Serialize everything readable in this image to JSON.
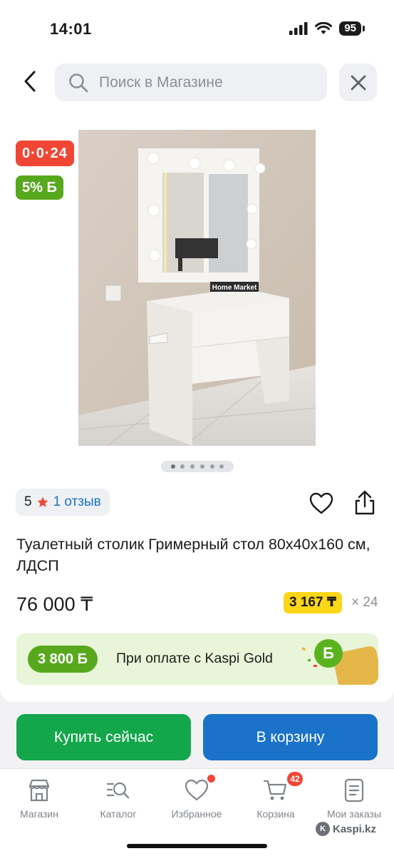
{
  "status_bar": {
    "time": "14:01",
    "battery": "95"
  },
  "header": {
    "search_placeholder": "Поиск в Магазине"
  },
  "product": {
    "badge_installment": "0·0·24",
    "badge_bonus": "5% Б",
    "image_brand_text": "Home Market",
    "gallery": {
      "total": 6,
      "active": 1
    },
    "rating": {
      "score": "5",
      "reviews": "1 отзыв"
    },
    "title": "Туалетный столик Гримерный стол 80х40х160 см, ЛДСП",
    "price": "76 000 ₸",
    "installment_price": "3 167 ₸",
    "installment_months": "× 24"
  },
  "gold_banner": {
    "bonus": "3 800 Б",
    "text": "При оплате с Kaspi Gold",
    "b_symbol": "Б"
  },
  "actions": {
    "buy_label": "Купить сейчас",
    "cart_label": "В корзину"
  },
  "tabbar": {
    "items": [
      {
        "label": "Магазин"
      },
      {
        "label": "Каталог"
      },
      {
        "label": "Избранное"
      },
      {
        "label": "Корзина",
        "badge": "42"
      },
      {
        "label": "Мои заказы"
      }
    ]
  },
  "watermark": "Kaspi.kz",
  "colors": {
    "accent_blue": "#1a73c9",
    "buy_green": "#14a64b",
    "red": "#f14635",
    "bonus_green": "#58a81e",
    "yellow": "#fcd617"
  }
}
